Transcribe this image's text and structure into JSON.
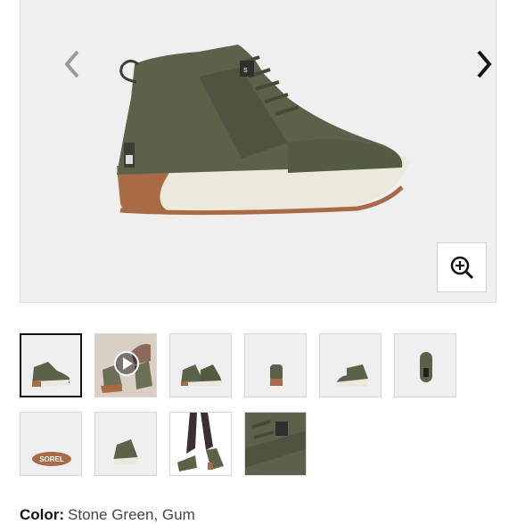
{
  "gallery": {
    "thumbnails": [
      {
        "name": "thumbnail-side-view",
        "active": true
      },
      {
        "name": "thumbnail-video",
        "active": false
      },
      {
        "name": "thumbnail-pair-view",
        "active": false
      },
      {
        "name": "thumbnail-front-view",
        "active": false
      },
      {
        "name": "thumbnail-angle-view",
        "active": false
      },
      {
        "name": "thumbnail-back-view",
        "active": false
      },
      {
        "name": "thumbnail-sole-view",
        "active": false
      },
      {
        "name": "thumbnail-top-view",
        "active": false
      },
      {
        "name": "thumbnail-model-view",
        "active": false
      },
      {
        "name": "thumbnail-detail-view",
        "active": false
      }
    ],
    "sole_logo_text": "SOREL"
  },
  "product": {
    "color_label": "Color:",
    "color_value": "Stone Green, Gum"
  },
  "colors": {
    "shoe_upper": "#5b6249",
    "shoe_sole": "#a86b45",
    "midsole": "#ede8dc",
    "background": "#efefef"
  }
}
